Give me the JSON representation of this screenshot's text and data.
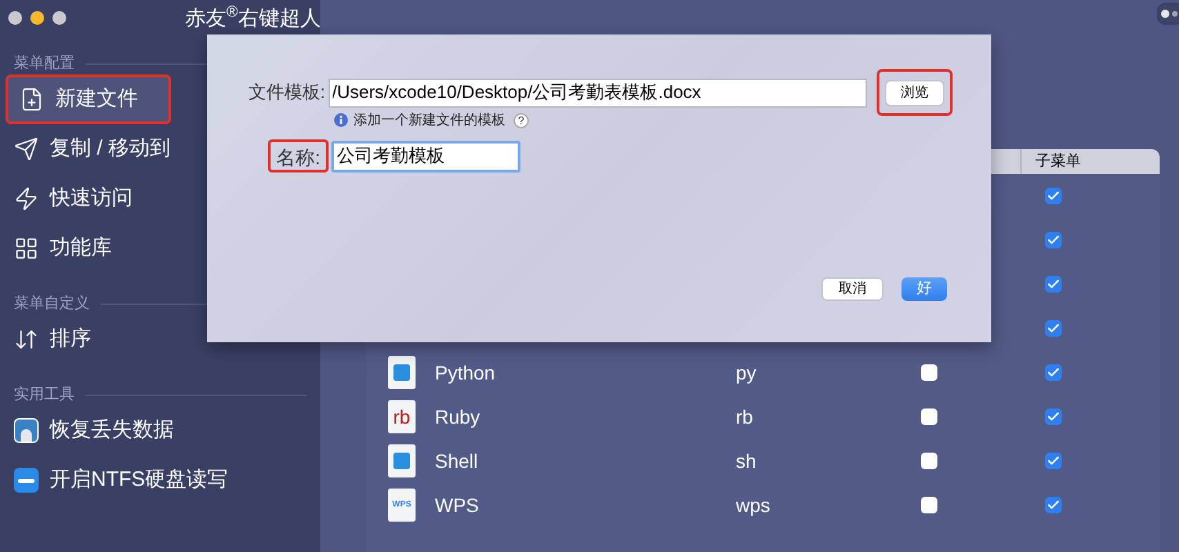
{
  "window": {
    "title": "赤友$^{®}$右键超人"
  },
  "sidebar": {
    "sections": [
      {
        "title": "菜单配置",
        "items": [
          {
            "label": "新建文件",
            "kind": "file",
            "selected": true,
            "annotated": true
          },
          {
            "label": "复制 / 移动到",
            "kind": "send",
            "selected": false,
            "annotated": false
          },
          {
            "label": "快速访问",
            "kind": "bolt",
            "selected": false,
            "annotated": false
          },
          {
            "label": "功能库",
            "kind": "grid",
            "selected": false,
            "annotated": false
          }
        ]
      },
      {
        "title": "菜单自定义",
        "items": [
          {
            "label": "排序",
            "kind": "sort",
            "selected": false,
            "annotated": false
          }
        ]
      },
      {
        "title": "实用工具",
        "items": [
          {
            "label": "恢复丢失数据",
            "kind": "app",
            "selected": false,
            "annotated": false
          },
          {
            "label": "开启NTFS硬盘读写",
            "kind": "disk",
            "selected": false,
            "annotated": false
          }
        ]
      }
    ]
  },
  "table": {
    "columns": [
      {
        "label": "子菜单"
      }
    ],
    "rows": [
      {
        "submenu": true
      },
      {
        "submenu": true
      },
      {
        "submenu": true
      },
      {
        "submenu": true
      },
      {
        "name": "Python",
        "ext": "py",
        "kind": "doc",
        "checked": false,
        "submenu": true
      },
      {
        "name": "Ruby",
        "ext": "rb",
        "kind": "labeled",
        "icon_label": "rb",
        "checked": false,
        "submenu": true
      },
      {
        "name": "Shell",
        "ext": "sh",
        "kind": "doc",
        "checked": false,
        "submenu": true
      },
      {
        "name": "WPS",
        "ext": "wps",
        "kind": "small-label",
        "icon_label": "WPS",
        "checked": false,
        "submenu": true
      }
    ]
  },
  "dialog": {
    "template_label": "文件模板:",
    "template_value": "/Users/xcode10/Desktop/公司考勤表模板.docx",
    "browse_button": {
      "label": "浏览",
      "annotated": true
    },
    "hint": "添加一个新建文件的模板",
    "help": "?",
    "name_label": {
      "label": "名称:",
      "annotated": true
    },
    "name_value": "公司考勤模板",
    "buttons": [
      {
        "label": "取消",
        "kind": "cancel"
      },
      {
        "label": "好",
        "kind": "default"
      }
    ]
  }
}
